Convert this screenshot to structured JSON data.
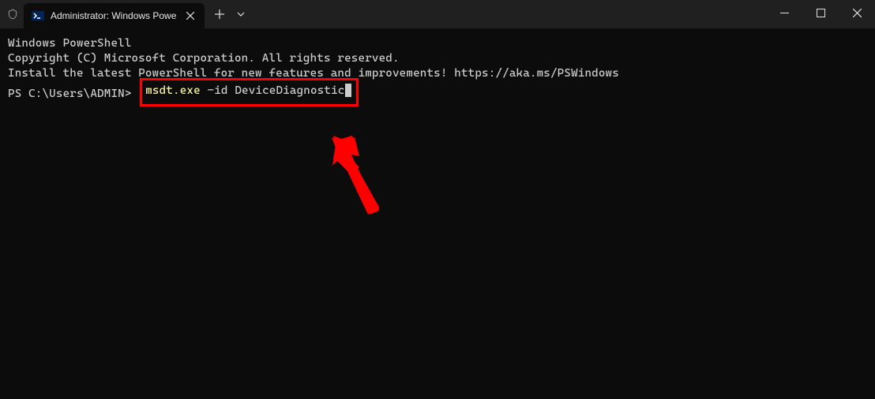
{
  "titlebar": {
    "tab_title": "Administrator: Windows Powe",
    "shield_icon": "shield",
    "ps_icon": "powershell"
  },
  "terminal": {
    "line1": "Windows PowerShell",
    "line2": "Copyright (C) Microsoft Corporation. All rights reserved.",
    "line3": "",
    "line4": "Install the latest PowerShell for new features and improvements! https://aka.ms/PSWindows",
    "line5": "",
    "prompt": "PS C:\\Users\\ADMIN>",
    "cmd_exe": "msdt.exe",
    "cmd_flag": "-id",
    "cmd_arg": "DeviceDiagnostic"
  },
  "annotation": {
    "highlight_color": "#ff0000"
  }
}
